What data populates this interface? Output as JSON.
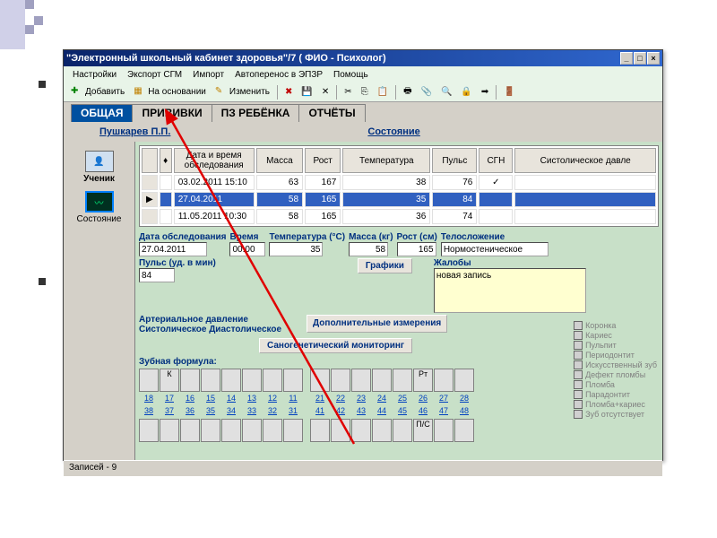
{
  "window": {
    "title": "\"Электронный школьный кабинет здоровья\"/7 ( ФИО - Психолог)",
    "buttons": {
      "min": "_",
      "max": "□",
      "close": "×"
    }
  },
  "menu": [
    "Настройки",
    "Экспорт СГМ",
    "Импорт",
    "Автоперенос в ЭПЗР",
    "Помощь"
  ],
  "toolbar": {
    "add": "Добавить",
    "based_on": "На основании",
    "edit": "Изменить"
  },
  "tabs": [
    "ОБЩАЯ",
    "ПРИВИВКИ",
    "ПЗ РЕБЁНКА",
    "ОТЧЁТЫ"
  ],
  "student_name": "Пушкарев П.П.",
  "condition_label": "Состояние",
  "left_panel": {
    "student": "Ученик",
    "condition": "Состояние"
  },
  "table": {
    "headers": [
      "",
      "♦",
      "Дата и время обследования",
      "Масса",
      "Рост",
      "Температура",
      "Пульс",
      "СГН",
      "Систолическое давле"
    ],
    "rows": [
      {
        "marker": "",
        "date": "03.02.2011 15:10",
        "mass": "63",
        "height": "167",
        "temp": "38",
        "pulse": "76",
        "sgn": "✓",
        "sys": ""
      },
      {
        "marker": "▶",
        "date": "27.04.2011",
        "mass": "58",
        "height": "165",
        "temp": "35",
        "pulse": "84",
        "sgn": "",
        "sys": ""
      },
      {
        "marker": "",
        "date": "11.05.2011 10:30",
        "mass": "58",
        "height": "165",
        "temp": "36",
        "pulse": "74",
        "sgn": "",
        "sys": ""
      }
    ]
  },
  "form": {
    "labels": {
      "exam_date": "Дата обследования",
      "time": "Время",
      "temp": "Температура (°C)",
      "mass": "Масса (кг)",
      "height": "Рост (см)",
      "body": "Телосложение",
      "pulse": "Пульс (уд. в мин)",
      "bp": "Артериальное давление",
      "sys": "Систолическое",
      "dia": "Диастолическое",
      "complaints": "Жалобы"
    },
    "values": {
      "exam_date": "27.04.2011",
      "time": "00:00",
      "temp": "35",
      "mass": "58",
      "height": "165",
      "body": "Нормостеническое",
      "pulse": "84",
      "complaints": "новая запись"
    },
    "buttons": {
      "charts": "Графики",
      "extra": "Дополнительные измерения",
      "sano": "Саногенетический мониторинг"
    }
  },
  "dental": {
    "label": "Зубная формула:",
    "marker_k": "К",
    "marker_pt": "Рт",
    "marker_pc": "П/С",
    "top_nums": [
      "18",
      "17",
      "16",
      "15",
      "14",
      "13",
      "12",
      "11",
      "21",
      "22",
      "23",
      "24",
      "25",
      "26",
      "27",
      "28"
    ],
    "bot_nums": [
      "38",
      "37",
      "36",
      "35",
      "34",
      "33",
      "32",
      "31",
      "41",
      "42",
      "43",
      "44",
      "45",
      "46",
      "47",
      "48"
    ],
    "legend": [
      "Коронка",
      "Кариес",
      "Пульпит",
      "Периодонтит",
      "Искусственный зуб",
      "Дефект пломбы",
      "Пломба",
      "Парадонтит",
      "Пломба+кариес",
      "Зуб отсутствует"
    ]
  },
  "statusbar": "Записей - 9"
}
